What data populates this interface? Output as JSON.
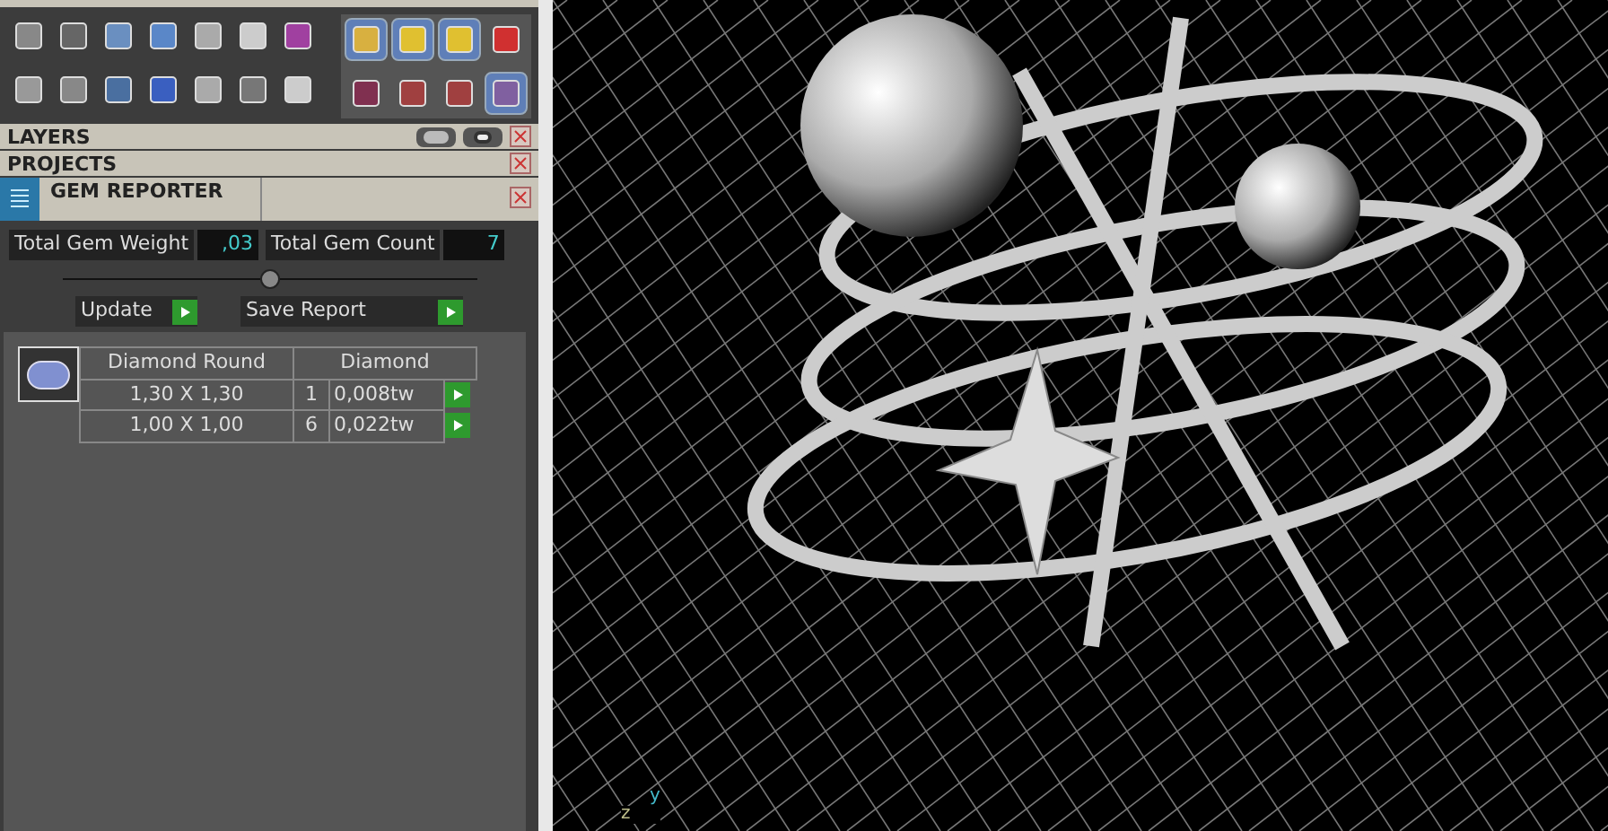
{
  "sections": [
    {
      "title": "LAYERS",
      "kind": "layers"
    },
    {
      "title": "PROJECTS",
      "kind": "plain"
    }
  ],
  "gem_reporter": {
    "title": "GEM REPORTER",
    "totals": [
      {
        "label": "Total Gem Weight",
        "value": ",03"
      },
      {
        "label": "Total Gem Count",
        "value": "7"
      }
    ],
    "buttons": [
      "Update",
      "Save Report"
    ],
    "table": {
      "columns": [
        "Diamond Round",
        "Diamond"
      ],
      "rows": [
        {
          "size": "1,30 X 1,30",
          "count": "1",
          "weight": "0,008tw"
        },
        {
          "size": "1,00 X 1,00",
          "count": "6",
          "weight": "0,022tw"
        }
      ]
    }
  },
  "viewport": {
    "axis_labels": [
      "y",
      "z"
    ]
  }
}
